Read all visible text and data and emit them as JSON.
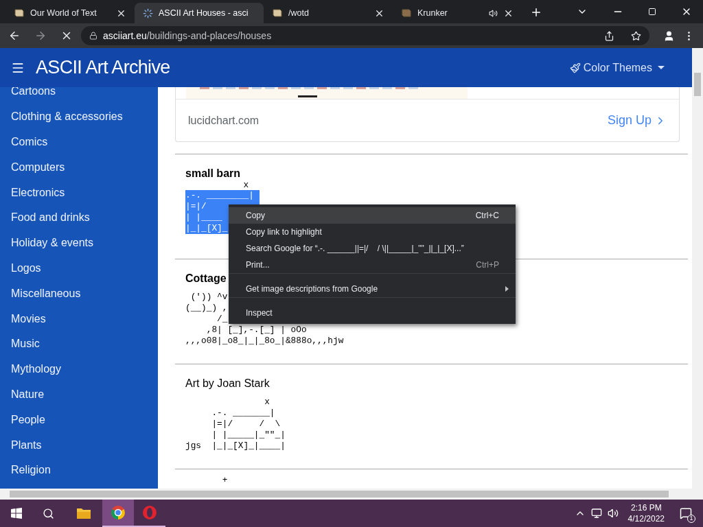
{
  "browser": {
    "tabs": [
      {
        "title": "Our World of Text",
        "selected": false,
        "loading": false,
        "audio": false
      },
      {
        "title": "ASCII Art Houses - asci",
        "selected": true,
        "loading": true,
        "audio": false
      },
      {
        "title": "/wotd",
        "selected": false,
        "loading": false,
        "audio": false
      },
      {
        "title": "Krunker",
        "selected": false,
        "loading": false,
        "audio": true
      }
    ],
    "url_host": "asciiart.eu",
    "url_path": "/buildings-and-places/houses"
  },
  "header": {
    "title": "ASCII Art Archive",
    "themes_button": "Color Themes"
  },
  "sidebar": {
    "items": [
      "Cartoons",
      "Clothing & accessories",
      "Comics",
      "Computers",
      "Electronics",
      "Food and drinks",
      "Holiday & events",
      "Logos",
      "Miscellaneous",
      "Movies",
      "Music",
      "Mythology",
      "Nature",
      "People",
      "Plants",
      "Religion"
    ]
  },
  "ad": {
    "domain": "lucidchart.com",
    "cta": "Sign Up"
  },
  "sections": [
    {
      "title": "small barn",
      "bold": true,
      "art_top": "           x",
      "selected": true,
      "art": [
        ".-. ________|",
        "|=|/",
        "| |____",
        "|_|_[X]_"
      ]
    },
    {
      "title": "Cottage",
      "bold": true,
      "selected": false,
      "art": [
        " (')) ^v",
        "(__)_) ,",
        "      /_",
        "    ,8| [_],-.[_] | oOo",
        ",,,o08|_o8_|_|_8o_|&888o,,,hjw"
      ]
    },
    {
      "title": "Art by Joan Stark",
      "bold": false,
      "selected": false,
      "art": [
        "               x",
        "     .-. _______|",
        "     |=|/     /  \\",
        "     | |_____|_\"\"_|",
        "jgs  |_|_[X]_|____|"
      ]
    }
  ],
  "next_art": "       +",
  "context_menu": [
    {
      "label": "Copy",
      "shortcut": "Ctrl+C",
      "highlighted": true,
      "submenu": false,
      "separator_before": false
    },
    {
      "label": "Copy link to highlight",
      "highlighted": false,
      "submenu": false,
      "separator_before": false
    },
    {
      "label": "Search Google for “.-. ______||=|/    / \\||_____|_\"\"_||_|_[X]...”",
      "highlighted": false,
      "submenu": false,
      "separator_before": false
    },
    {
      "label": "Print...",
      "shortcut": "Ctrl+P",
      "highlighted": false,
      "submenu": false,
      "separator_before": false
    },
    {
      "label": "Get image descriptions from Google",
      "highlighted": false,
      "submenu": true,
      "separator_before": true
    },
    {
      "label": "Inspect",
      "highlighted": false,
      "submenu": false,
      "separator_before": true
    }
  ],
  "taskbar": {
    "time": "2:16 PM",
    "date": "4/12/2022",
    "notifications": "1"
  }
}
